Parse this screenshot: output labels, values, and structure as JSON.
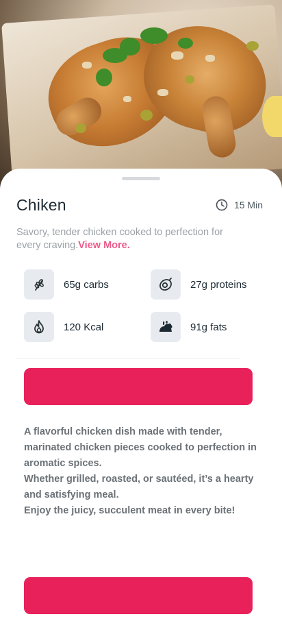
{
  "recipe": {
    "title": "Chiken",
    "time": "15 Min",
    "description": "Savory, tender chicken cooked to perfection for every craving.",
    "view_more": "View More."
  },
  "nutrition": [
    {
      "icon": "wheat-icon",
      "label": "65g carbs"
    },
    {
      "icon": "avocado-icon",
      "label": "27g proteins"
    },
    {
      "icon": "flame-icon",
      "label": "120 Kcal"
    },
    {
      "icon": "pizza-icon",
      "label": "91g fats"
    }
  ],
  "details": [
    "A flavorful chicken dish made with tender, marinated chicken pieces cooked to perfection in aromatic spices.",
    "Whether grilled, roasted, or sautéed, it’s a hearty and satisfying meal.",
    "Enjoy the juicy, succulent meat in every bite!"
  ],
  "colors": {
    "accent": "#e8215a",
    "link": "#ec5c8b",
    "icon_bg": "#e7ebef"
  }
}
